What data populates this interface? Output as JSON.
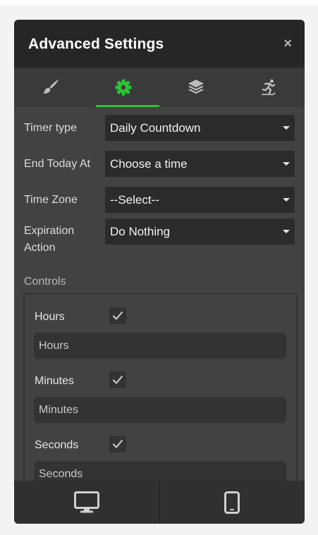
{
  "panel": {
    "title": "Advanced Settings",
    "close_label": "×"
  },
  "tabs": [
    {
      "icon": "paintbrush-icon",
      "active": false
    },
    {
      "icon": "gear-icon",
      "active": true
    },
    {
      "icon": "layers-icon",
      "active": false
    },
    {
      "icon": "skater-icon",
      "active": false
    }
  ],
  "fields": {
    "timer_type": {
      "label": "Timer type",
      "value": "Daily Countdown"
    },
    "end_today_at": {
      "label": "End Today At",
      "value": "Choose a time"
    },
    "time_zone": {
      "label": "Time Zone",
      "value": "--Select--"
    },
    "expiration_action": {
      "label_line1": "Expiration",
      "label_line2": "Action",
      "value": "Do Nothing"
    }
  },
  "controls": {
    "label": "Controls",
    "hours": {
      "label": "Hours",
      "checked": true,
      "input_value": "Hours"
    },
    "minutes": {
      "label": "Minutes",
      "checked": true,
      "input_value": "Minutes"
    },
    "seconds": {
      "label": "Seconds",
      "checked": true,
      "input_value": "Seconds"
    }
  },
  "footer": {
    "devices": [
      "desktop-icon",
      "mobile-icon"
    ]
  },
  "colors": {
    "accent": "#30c03a",
    "panel_bg": "#424242",
    "header_bg": "#262626"
  }
}
